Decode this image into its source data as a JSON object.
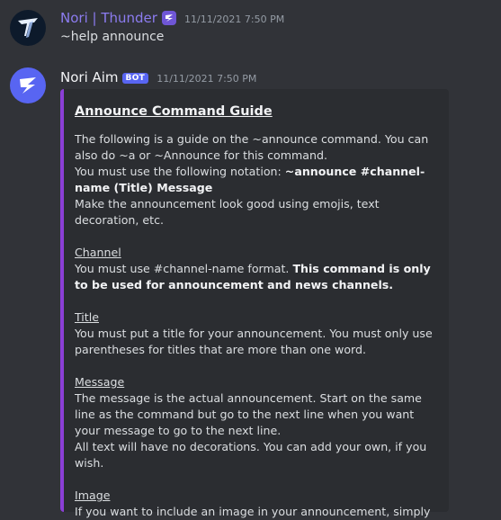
{
  "messages": [
    {
      "username": "Nori | Thunder",
      "timestamp": "11/11/2021 7:50 PM",
      "content": "~help announce",
      "role_icon": "nori-role-icon",
      "avatar_icon": "thunder-logo-icon"
    },
    {
      "username": "Nori Aim",
      "bot_tag": "BOT",
      "timestamp": "11/11/2021 7:50 PM",
      "avatar_icon": "nori-bot-logo-icon",
      "embed": {
        "accent_color": "#8b3fd6",
        "title": "Announce Command Guide",
        "intro_1": "The following is a guide on the ~announce command. You can also do ~a or ~Announce for this command.",
        "intro_2": "You must use the following notation: ",
        "intro_2_bold": "~announce #channel-name (Title) Message",
        "intro_3": "Make the announcement look good using emojis, text decoration, etc.",
        "channel_heading": "Channel",
        "channel_text": "You must use #channel-name format. ",
        "channel_bold": "This command is only to be used for announcement and news channels.",
        "title_heading": "Title",
        "title_text": "You must put a title for your announcement. You must only use parentheses for titles that are more than one word.",
        "message_heading": "Message",
        "message_text_1": "The message is the actual announcement. Start on the same line as the command but go to the next line when you want your message to go to the next line.",
        "message_text_2": "All text will have no decorations. You can add your own, if you wish.",
        "image_heading": "Image",
        "image_text": "If you want to include an image in your announcement, simply"
      }
    }
  ],
  "colors": {
    "background": "#313338",
    "embed_background": "#2b2d31",
    "username_thunder": "#8c7cf0",
    "bot_tag": "#5865f2"
  }
}
